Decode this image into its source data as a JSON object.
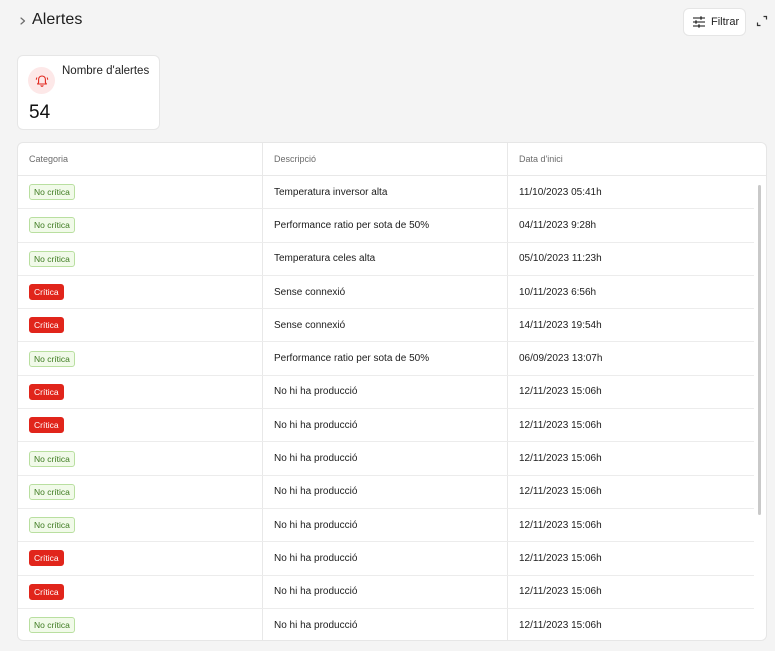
{
  "header": {
    "title": "Alertes",
    "filter_label": "Filtrar"
  },
  "kpi": {
    "label": "Nombre d'alertes",
    "value": "54"
  },
  "table": {
    "columns": [
      "Categoria",
      "Descripció",
      "Data d'inici"
    ],
    "rows": [
      {
        "category": "No crítica",
        "severity": "no",
        "description": "Temperatura inversor alta",
        "date": "11/10/2023 05:41h"
      },
      {
        "category": "No crítica",
        "severity": "no",
        "description": "Performance ratio per sota de 50%",
        "date": "04/11/2023 9:28h"
      },
      {
        "category": "No crítica",
        "severity": "no",
        "description": "Temperatura celes alta",
        "date": "05/10/2023 11:23h"
      },
      {
        "category": "Crítica",
        "severity": "crit",
        "description": "Sense connexió",
        "date": "10/11/2023 6:56h"
      },
      {
        "category": "Crítica",
        "severity": "crit",
        "description": "Sense connexió",
        "date": "14/11/2023 19:54h"
      },
      {
        "category": "No crítica",
        "severity": "no",
        "description": "Performance ratio per sota de 50%",
        "date": "06/09/2023 13:07h"
      },
      {
        "category": "Crítica",
        "severity": "crit",
        "description": "No hi ha producció",
        "date": "12/11/2023 15:06h"
      },
      {
        "category": "Crítica",
        "severity": "crit",
        "description": "No hi ha producció",
        "date": "12/11/2023 15:06h"
      },
      {
        "category": "No crítica",
        "severity": "no",
        "description": "No hi ha producció",
        "date": "12/11/2023 15:06h"
      },
      {
        "category": "No crítica",
        "severity": "no",
        "description": "No hi ha producció",
        "date": "12/11/2023 15:06h"
      },
      {
        "category": "No crítica",
        "severity": "no",
        "description": "No hi ha producció",
        "date": "12/11/2023 15:06h"
      },
      {
        "category": "Crítica",
        "severity": "crit",
        "description": "No hi ha producció",
        "date": "12/11/2023 15:06h"
      },
      {
        "category": "Crítica",
        "severity": "crit",
        "description": "No hi ha producció",
        "date": "12/11/2023 15:06h"
      },
      {
        "category": "No crítica",
        "severity": "no",
        "description": "No hi ha producció",
        "date": "12/11/2023 15:06h"
      }
    ]
  },
  "colors": {
    "critical": "#e1251b",
    "non_critical_bg": "#f1fae9",
    "non_critical_text": "#3c7a1f",
    "alert_icon": "#e1251b"
  },
  "icons": {
    "breadcrumb": "chevron-right-icon",
    "filter": "sliders-icon",
    "expand": "expand-icon",
    "kpi": "bell-alert-icon"
  }
}
